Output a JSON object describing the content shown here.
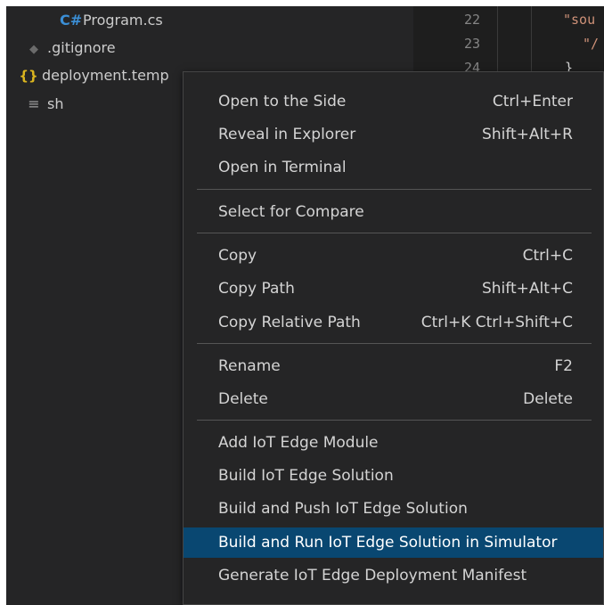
{
  "explorer": {
    "files": [
      {
        "name": "Program.cs",
        "icon": "csharp-icon",
        "glyph": "C#",
        "color": "#3b8fd6"
      },
      {
        "name": ".gitignore",
        "icon": "git-icon",
        "glyph": "◆",
        "color": "#6b6b6b"
      },
      {
        "name": "deployment.temp",
        "icon": "json-braces-icon",
        "glyph": "{}",
        "color": "#dbb51f"
      },
      {
        "name": "sh",
        "icon": "text-lines-icon",
        "glyph": "≡",
        "color": "#a0a0a0"
      }
    ]
  },
  "editor": {
    "line_numbers": [
      "22",
      "23",
      "24"
    ],
    "lines": [
      "\"sou",
      "\"/",
      "}"
    ]
  },
  "context_menu": {
    "groups": [
      [
        {
          "label": "Open to the Side",
          "shortcut": "Ctrl+Enter"
        },
        {
          "label": "Reveal in Explorer",
          "shortcut": "Shift+Alt+R"
        },
        {
          "label": "Open in Terminal",
          "shortcut": ""
        }
      ],
      [
        {
          "label": "Select for Compare",
          "shortcut": ""
        }
      ],
      [
        {
          "label": "Copy",
          "shortcut": "Ctrl+C"
        },
        {
          "label": "Copy Path",
          "shortcut": "Shift+Alt+C"
        },
        {
          "label": "Copy Relative Path",
          "shortcut": "Ctrl+K Ctrl+Shift+C"
        }
      ],
      [
        {
          "label": "Rename",
          "shortcut": "F2"
        },
        {
          "label": "Delete",
          "shortcut": "Delete"
        }
      ],
      [
        {
          "label": "Add IoT Edge Module",
          "shortcut": ""
        },
        {
          "label": "Build IoT Edge Solution",
          "shortcut": ""
        },
        {
          "label": "Build and Push IoT Edge Solution",
          "shortcut": ""
        },
        {
          "label": "Build and Run IoT Edge Solution in Simulator",
          "shortcut": "",
          "highlighted": true
        },
        {
          "label": "Generate IoT Edge Deployment Manifest",
          "shortcut": ""
        }
      ]
    ]
  },
  "colors": {
    "sidebar_bg": "#252526",
    "editor_bg": "#1e1e1e",
    "menu_highlight": "#094771",
    "string_color": "#ce9178"
  }
}
